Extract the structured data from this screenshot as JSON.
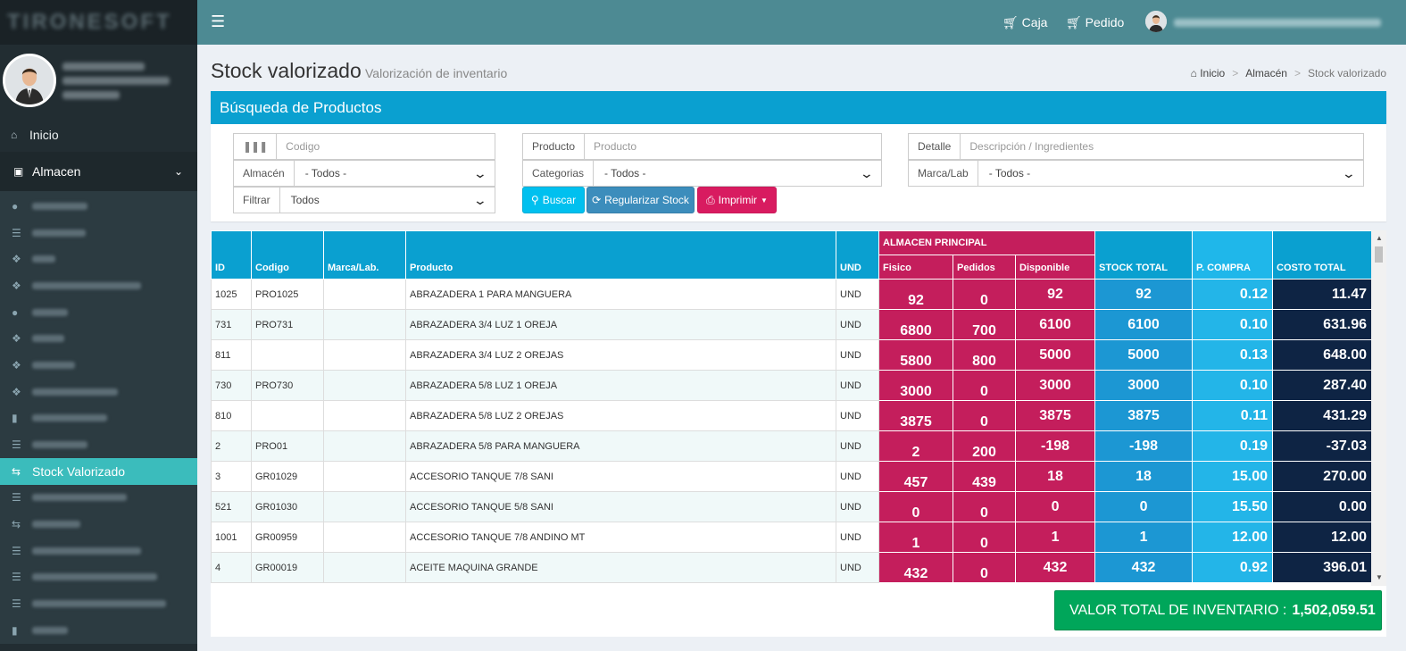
{
  "brand": {
    "logo_text": "TIRONESOFT"
  },
  "sidebar": {
    "inicio": "Inicio",
    "section": "Almacen",
    "active_item": "Stock Valorizado"
  },
  "topbar": {
    "caja": "Caja",
    "pedido": "Pedido"
  },
  "page": {
    "title": "Stock valorizado",
    "subtitle": "Valorización de inventario"
  },
  "breadcrumb": {
    "home": "Inicio",
    "section": "Almacén",
    "current": "Stock valorizado"
  },
  "search": {
    "title": "Búsqueda de Productos",
    "codigo_placeholder": "Codigo",
    "almacen_label": "Almacén",
    "almacen_value": "- Todos -",
    "filtrar_label": "Filtrar",
    "filtrar_value": "Todos",
    "producto_label": "Producto",
    "producto_placeholder": "Producto",
    "categorias_label": "Categorias",
    "categorias_value": "- Todos -",
    "detalle_label": "Detalle",
    "detalle_placeholder": "Descripción / Ingredientes",
    "marca_label": "Marca/Lab",
    "marca_value": "- Todos -",
    "buscar": "Buscar",
    "regularizar": "Regularizar Stock",
    "imprimir": "Imprimir"
  },
  "table": {
    "headers": {
      "id": "ID",
      "codigo": "Codigo",
      "marca": "Marca/Lab.",
      "producto": "Producto",
      "und": "UND",
      "almacen_group": "ALMACEN PRINCIPAL",
      "fisico": "Fisico",
      "pedidos": "Pedidos",
      "disponible": "Disponible",
      "stock_total": "STOCK TOTAL",
      "p_compra": "P. COMPRA",
      "costo_total": "COSTO TOTAL"
    },
    "rows": [
      {
        "id": "1025",
        "codigo": "PRO1025",
        "marca": "",
        "producto": "ABRAZADERA 1 PARA MANGUERA",
        "und": "UND",
        "fisico": "92",
        "pedidos": "0",
        "disponible": "92",
        "stock_total": "92",
        "p_compra": "0.12",
        "costo_total": "11.47"
      },
      {
        "id": "731",
        "codigo": "PRO731",
        "marca": "",
        "producto": "ABRAZADERA 3/4 LUZ 1 OREJA",
        "und": "UND",
        "fisico": "6800",
        "pedidos": "700",
        "disponible": "6100",
        "stock_total": "6100",
        "p_compra": "0.10",
        "costo_total": "631.96"
      },
      {
        "id": "811",
        "codigo": "",
        "marca": "",
        "producto": "ABRAZADERA 3/4 LUZ 2 OREJAS",
        "und": "UND",
        "fisico": "5800",
        "pedidos": "800",
        "disponible": "5000",
        "stock_total": "5000",
        "p_compra": "0.13",
        "costo_total": "648.00"
      },
      {
        "id": "730",
        "codigo": "PRO730",
        "marca": "",
        "producto": "ABRAZADERA 5/8 LUZ 1 OREJA",
        "und": "UND",
        "fisico": "3000",
        "pedidos": "0",
        "disponible": "3000",
        "stock_total": "3000",
        "p_compra": "0.10",
        "costo_total": "287.40"
      },
      {
        "id": "810",
        "codigo": "",
        "marca": "",
        "producto": "ABRAZADERA 5/8 LUZ 2 OREJAS",
        "und": "UND",
        "fisico": "3875",
        "pedidos": "0",
        "disponible": "3875",
        "stock_total": "3875",
        "p_compra": "0.11",
        "costo_total": "431.29"
      },
      {
        "id": "2",
        "codigo": "PRO01",
        "marca": "",
        "producto": "ABRAZADERA 5/8 PARA MANGUERA",
        "und": "UND",
        "fisico": "2",
        "pedidos": "200",
        "disponible": "-198",
        "stock_total": "-198",
        "p_compra": "0.19",
        "costo_total": "-37.03"
      },
      {
        "id": "3",
        "codigo": "GR01029",
        "marca": "",
        "producto": "ACCESORIO TANQUE 7/8 SANI",
        "und": "UND",
        "fisico": "457",
        "pedidos": "439",
        "disponible": "18",
        "stock_total": "18",
        "p_compra": "15.00",
        "costo_total": "270.00"
      },
      {
        "id": "521",
        "codigo": "GR01030",
        "marca": "",
        "producto": "ACCESORIO TANQUE 5/8 SANI",
        "und": "UND",
        "fisico": "0",
        "pedidos": "0",
        "disponible": "0",
        "stock_total": "0",
        "p_compra": "15.50",
        "costo_total": "0.00"
      },
      {
        "id": "1001",
        "codigo": "GR00959",
        "marca": "",
        "producto": "ACCESORIO TANQUE 7/8 ANDINO MT",
        "und": "UND",
        "fisico": "1",
        "pedidos": "0",
        "disponible": "1",
        "stock_total": "1",
        "p_compra": "12.00",
        "costo_total": "12.00"
      },
      {
        "id": "4",
        "codigo": "GR00019",
        "marca": "",
        "producto": "ACEITE MAQUINA GRANDE",
        "und": "UND",
        "fisico": "432",
        "pedidos": "0",
        "disponible": "432",
        "stock_total": "432",
        "p_compra": "0.92",
        "costo_total": "396.01"
      }
    ]
  },
  "total": {
    "label": "VALOR TOTAL DE INVENTARIO :",
    "value": "1,502,059.51"
  },
  "colors": {
    "accent": "#0aa0d0",
    "pink": "#c41e5c",
    "navy": "#0e2444",
    "green": "#00a65a",
    "teal_active": "#3bbcbc"
  }
}
